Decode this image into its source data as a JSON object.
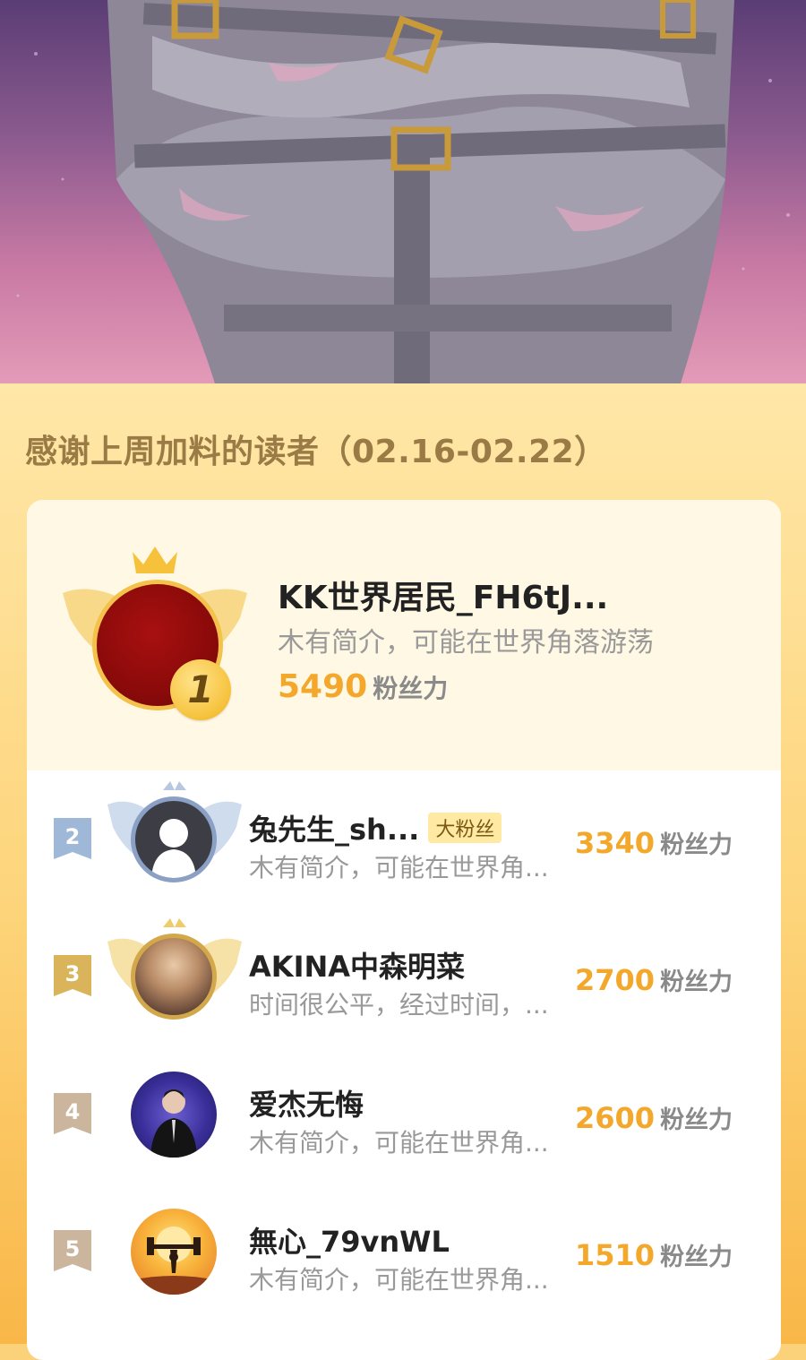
{
  "hero": {
    "image": "comic-character-in-strapped-jacket"
  },
  "section_title": "感谢上周加料的读者（02.16-02.22）",
  "top_reader": {
    "rank": "1",
    "name": "KK世界居民_FH6tJ...",
    "bio": "木有简介，可能在世界角落游荡",
    "score": "5490",
    "unit": "粉丝力"
  },
  "readers": [
    {
      "rank": "2",
      "name": "兔先生_sh...",
      "tag": "大粉丝",
      "bio": "木有简介，可能在世界角...",
      "score": "3340",
      "unit": "粉丝力"
    },
    {
      "rank": "3",
      "name": "AKINA中森明菜",
      "tag": "",
      "bio": "时间很公平，经过时间，...",
      "score": "2700",
      "unit": "粉丝力"
    },
    {
      "rank": "4",
      "name": "爱杰无悔",
      "tag": "",
      "bio": "木有简介，可能在世界角...",
      "score": "2600",
      "unit": "粉丝力"
    },
    {
      "rank": "5",
      "name": "無心_79vnWL",
      "tag": "",
      "bio": "木有简介，可能在世界角...",
      "score": "1510",
      "unit": "粉丝力"
    }
  ],
  "colors": {
    "accent": "#f3a82c",
    "panel": "#fdd47a",
    "badge_gold": "#f6c23c"
  }
}
